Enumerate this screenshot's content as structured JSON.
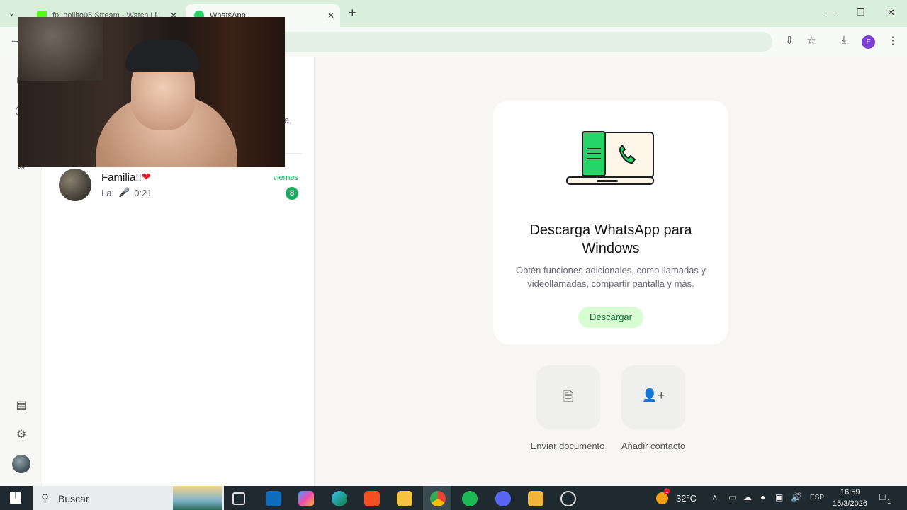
{
  "browser": {
    "tabs": [
      {
        "title": "fp_pollito05 Stream - Watch Li..."
      },
      {
        "title": "WhatsApp"
      }
    ],
    "new_tab": "+",
    "profile_initial": "F"
  },
  "chats": [
    {
      "name": "Familia!!",
      "preview_sender": "La:",
      "preview_duration": "0:21",
      "time": "viernes",
      "unread": "8"
    }
  ],
  "partial_text": "a,",
  "main": {
    "title": "Descarga WhatsApp para Windows",
    "subtitle": "Obtén funciones adicionales, como llamadas y videollamadas, compartir pantalla y más.",
    "button": "Descargar",
    "actions": [
      {
        "label": "Enviar documento",
        "icon": "document-icon"
      },
      {
        "label": "Añadir contacto",
        "icon": "add-contact-icon"
      }
    ]
  },
  "taskbar": {
    "search_placeholder": "Buscar",
    "weather": "32°C",
    "weather_badge": "1",
    "lang": "ESP",
    "time": "16:59",
    "date": "15/3/2026",
    "notification_count": "1"
  },
  "colors": {
    "accent": "#1daa61",
    "tabbar": "#d9eedb",
    "taskbar": "#1f2a30"
  }
}
